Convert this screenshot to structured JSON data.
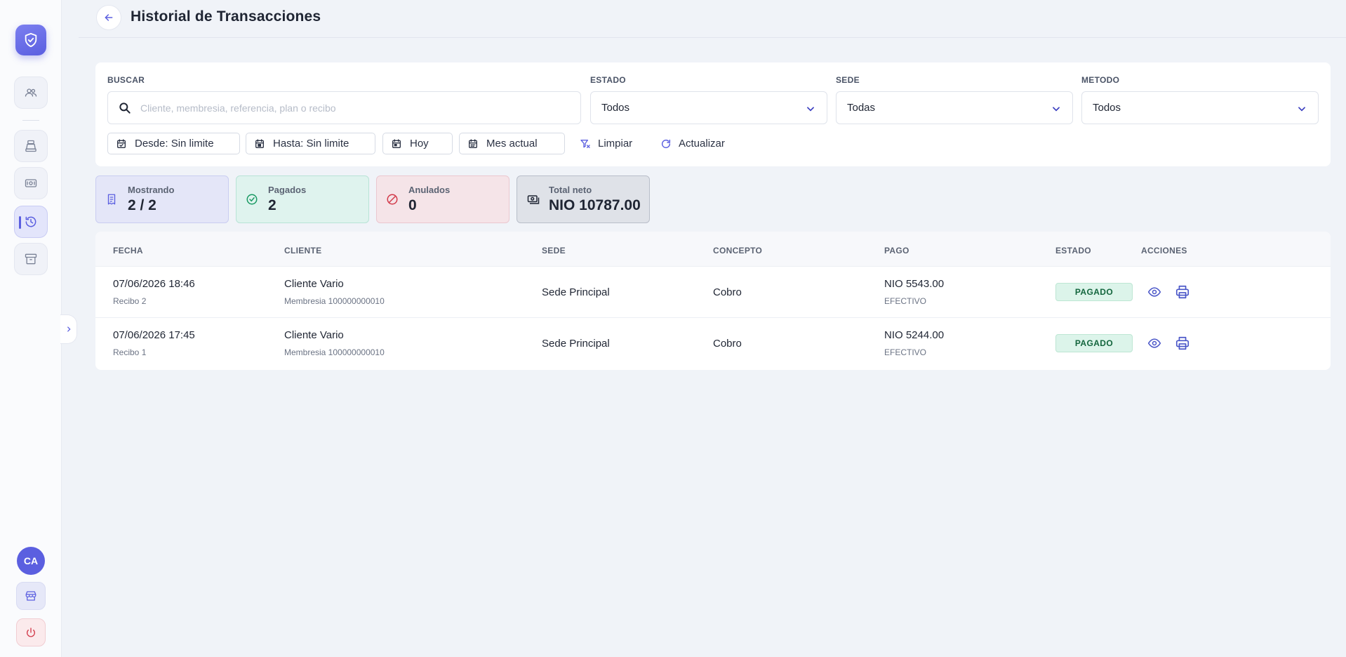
{
  "header": {
    "title": "Historial de Transacciones"
  },
  "sidebar": {
    "avatar_initials": "CA",
    "items": [
      {
        "icon": "users-icon"
      },
      {
        "icon": "cash-register-icon"
      },
      {
        "icon": "money-bill-icon"
      },
      {
        "icon": "history-icon",
        "active": true
      },
      {
        "icon": "archive-icon"
      }
    ]
  },
  "filters": {
    "search_label": "BUSCAR",
    "search_placeholder": "Cliente, membresia, referencia, plan o recibo",
    "estado_label": "ESTADO",
    "estado_value": "Todos",
    "sede_label": "SEDE",
    "sede_value": "Todas",
    "metodo_label": "METODO",
    "metodo_value": "Todos",
    "desde": "Desde: Sin limite",
    "hasta": "Hasta: Sin limite",
    "hoy": "Hoy",
    "mes_actual": "Mes actual",
    "limpiar": "Limpiar",
    "actualizar": "Actualizar"
  },
  "stats": {
    "mostrando_label": "Mostrando",
    "mostrando_value": "2 / 2",
    "pagados_label": "Pagados",
    "pagados_value": "2",
    "anulados_label": "Anulados",
    "anulados_value": "0",
    "total_label": "Total neto",
    "total_value": "NIO 10787.00"
  },
  "table": {
    "headers": [
      "FECHA",
      "CLIENTE",
      "SEDE",
      "CONCEPTO",
      "PAGO",
      "ESTADO",
      "ACCIONES"
    ],
    "rows": [
      {
        "fecha": "07/06/2026 18:46",
        "recibo": "Recibo 2",
        "cliente": "Cliente Vario",
        "membresia": "Membresia 100000000010",
        "sede": "Sede Principal",
        "concepto": "Cobro",
        "pago": "NIO 5543.00",
        "metodo": "EFECTIVO",
        "estado": "PAGADO"
      },
      {
        "fecha": "07/06/2026 17:45",
        "recibo": "Recibo 1",
        "cliente": "Cliente Vario",
        "membresia": "Membresia 100000000010",
        "sede": "Sede Principal",
        "concepto": "Cobro",
        "pago": "NIO 5244.00",
        "metodo": "EFECTIVO",
        "estado": "PAGADO"
      }
    ]
  },
  "colors": {
    "accent": "#5b5fe0",
    "success": "#14663e",
    "danger": "#d23a4a"
  }
}
